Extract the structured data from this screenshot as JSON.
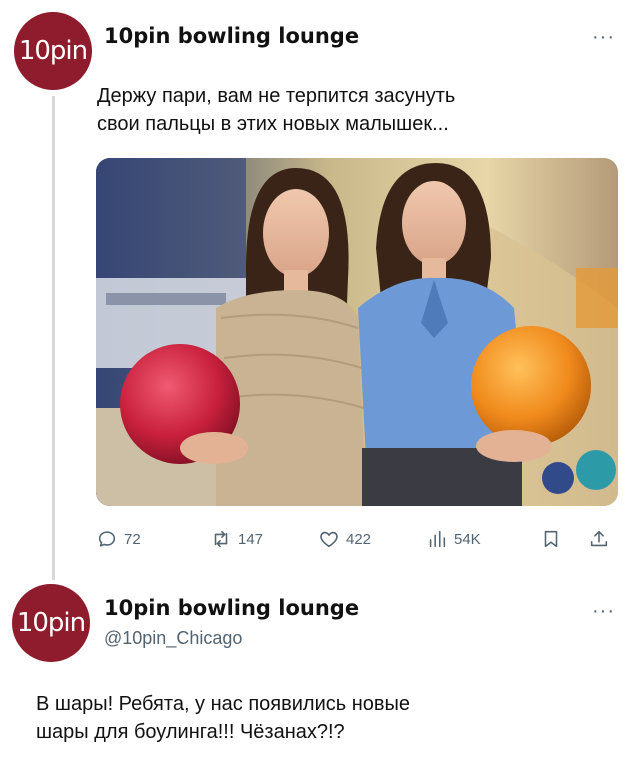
{
  "tweet1": {
    "avatar_text": "10pin",
    "author": "10pin bowling lounge",
    "more": "···",
    "text_lines": [
      "Держу пари, вам не терпится засунуть",
      "свои пальцы в этих новых малышек..."
    ],
    "actions": {
      "replies": "72",
      "retweets": "147",
      "likes": "422",
      "views": "54K"
    },
    "icons": [
      "reply-icon",
      "retweet-icon",
      "like-icon",
      "views-icon",
      "bookmark-icon",
      "share-icon"
    ]
  },
  "tweet2": {
    "avatar_text": "10pin",
    "author": "10pin bowling lounge",
    "handle": "@10pin_Chicago",
    "more": "···",
    "text_lines": [
      "В шары! Ребята, у нас появились новые",
      "шары для боулинга!!! Чёзанах?!?"
    ]
  },
  "colors": {
    "avatar": "#8e1c2c",
    "muted": "#536471",
    "red_ball": "#c8203c",
    "orange_ball": "#f08a1c",
    "blue_shirt": "#6d9ad6"
  }
}
